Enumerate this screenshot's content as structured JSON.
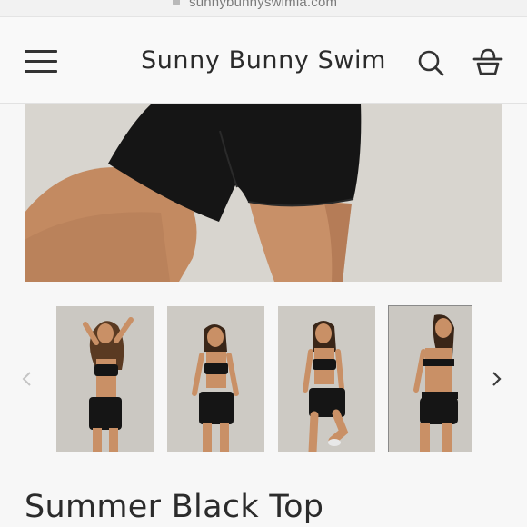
{
  "browser": {
    "url": "sunnybunnyswimla.com"
  },
  "header": {
    "brand": "Sunny Bunny Swim",
    "icons": {
      "menu": "hamburger-menu-icon",
      "search": "search-icon",
      "cart": "shopping-basket-icon"
    }
  },
  "gallery": {
    "hero_alt": "model wearing black bike shorts",
    "thumbnails": [
      {
        "alt": "front pose with hands in hair",
        "active": false
      },
      {
        "alt": "front standing pose",
        "active": false
      },
      {
        "alt": "side pose with raised knee",
        "active": false
      },
      {
        "alt": "back view pose",
        "active": true
      }
    ],
    "prev_icon": "chevron-left-icon",
    "next_icon": "chevron-right-icon"
  },
  "product": {
    "title": "Summer Black Top"
  },
  "colors": {
    "text": "#2b2b2b",
    "background": "#f7f7f7",
    "header_bg": "#f9f9f9",
    "garment": "#141414",
    "skin": "#c98f64"
  }
}
